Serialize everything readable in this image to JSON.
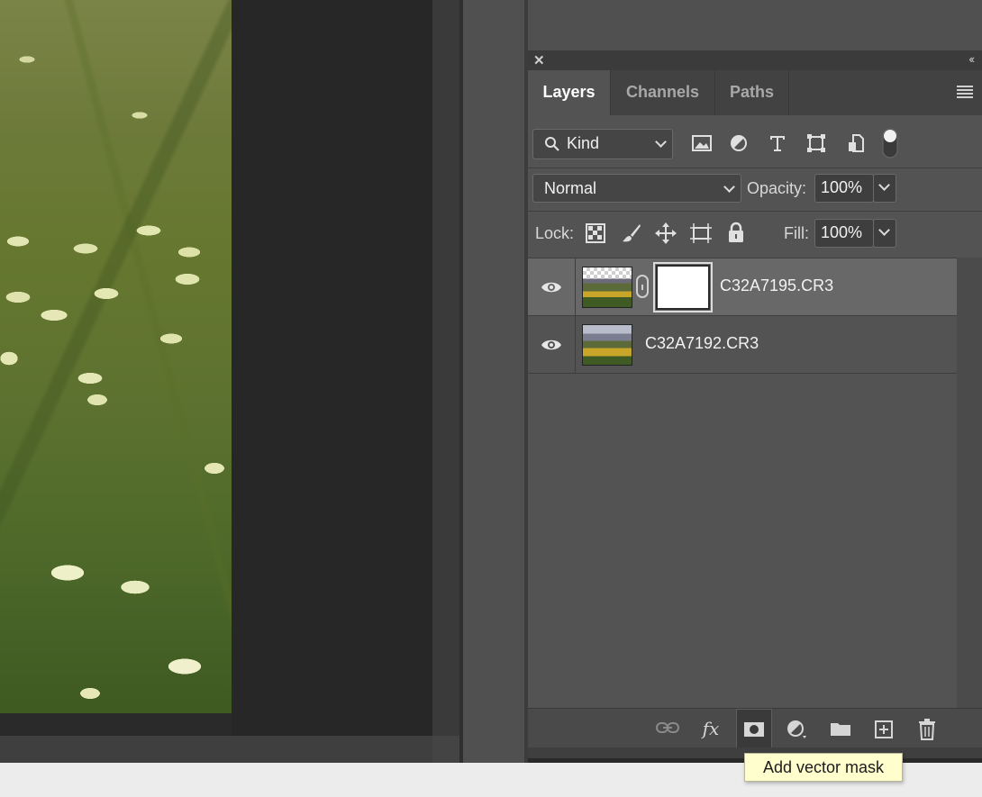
{
  "panel": {
    "tabs": [
      {
        "label": "Layers",
        "active": true
      },
      {
        "label": "Channels",
        "active": false
      },
      {
        "label": "Paths",
        "active": false
      }
    ],
    "filter": {
      "label": "Kind"
    },
    "blend_mode": "Normal",
    "opacity_label": "Opacity:",
    "opacity_value": "100%",
    "lock_label": "Lock:",
    "fill_label": "Fill:",
    "fill_value": "100%"
  },
  "layers": [
    {
      "name": "C32A7195.CR3",
      "visible": true,
      "selected": true,
      "has_mask": true
    },
    {
      "name": "C32A7192.CR3",
      "visible": true,
      "selected": false,
      "has_mask": false
    }
  ],
  "footer": {
    "fx_label": "fx"
  },
  "tooltip": "Add vector mask"
}
